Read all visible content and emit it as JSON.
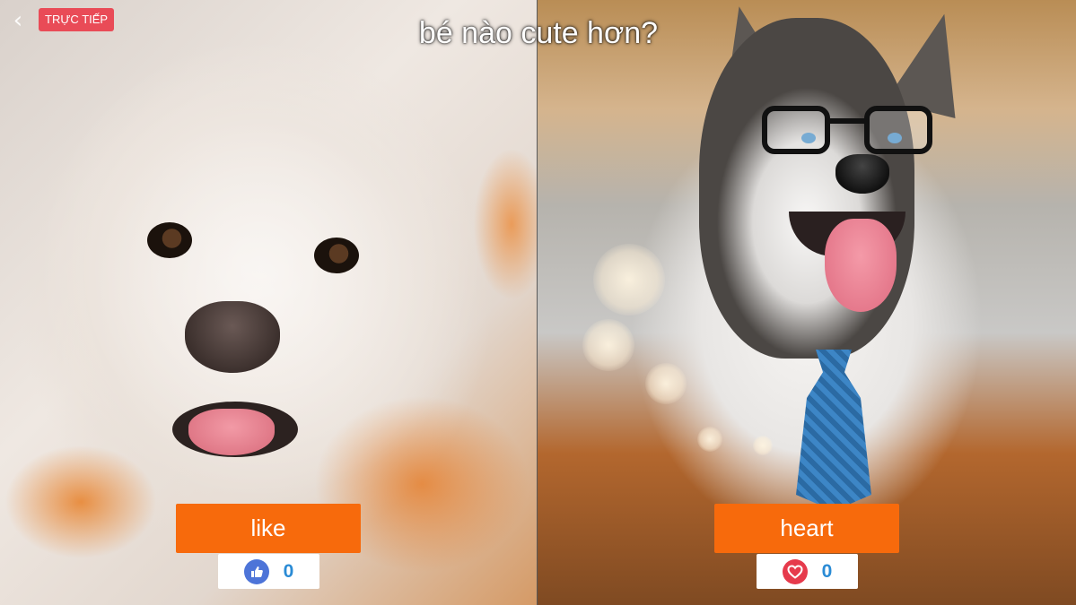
{
  "header": {
    "back_icon": "chevron-left-icon",
    "live_badge": "TRỰC TIẾP",
    "question": "bé nào cute hơn?"
  },
  "options": [
    {
      "button_label": "like",
      "count": "0",
      "icon": "thumbs-up-icon",
      "button_color": "#f76a0c",
      "icon_color": "#4d74d8"
    },
    {
      "button_label": "heart",
      "count": "0",
      "icon": "heart-icon",
      "button_color": "#f76a0c",
      "icon_color": "#e63a4c"
    }
  ],
  "colors": {
    "live_badge": "#e94b57",
    "count_text": "#2a8bd5"
  }
}
